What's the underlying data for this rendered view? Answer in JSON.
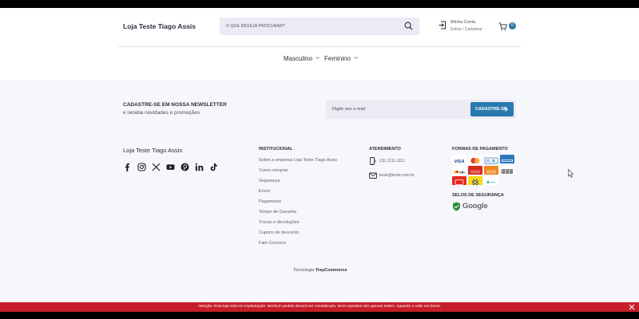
{
  "header": {
    "store_name": "Loja Teste Tiago Assis",
    "search_placeholder": "O QUE DESEJA PROCURAR?",
    "account_title": "Minha Conta",
    "account_sub": "Entrar / Cadastrar",
    "cart_count": "0"
  },
  "nav": {
    "items": [
      {
        "label": "Masculino"
      },
      {
        "label": "Feminino"
      }
    ]
  },
  "newsletter": {
    "title": "CADASTRE-SE EM NOSSA NEWSLETTER",
    "subtitle": "e receba novidades e promoções",
    "email_placeholder": "Digite seu e-mail",
    "button_label": "CADASTRE-SE"
  },
  "footer": {
    "store_name": "Loja Teste Tiago Assis",
    "social_icons": [
      "facebook-icon",
      "instagram-icon",
      "x-icon",
      "youtube-icon",
      "pinterest-icon",
      "linkedin-icon",
      "tiktok-icon"
    ],
    "institucional": {
      "title": "INSTITUCIONAL",
      "links": [
        "Sobre a empresa Loja Teste Tiago Assis",
        "Como comprar",
        "Segurança",
        "Envio",
        "Pagamento",
        "Tempo de Garantia",
        "Trocas e devoluções",
        "Cupons de desconto",
        "Fale Conosco"
      ]
    },
    "atendimento": {
      "title": "ATENDIMENTO",
      "phone": "(11) 1111-1111",
      "email": "teste@teste.com.br"
    },
    "pagamento": {
      "title": "FORMAS DE PAGAMENTO",
      "methods": [
        "visa",
        "mastercard",
        "amex-1",
        "amex-2",
        "elo",
        "hipercard",
        "diners",
        "boleto",
        "hiper",
        "banco-do-brasil",
        "pix"
      ]
    },
    "seguranca": {
      "title": "SELOS DE SEGURANÇA",
      "seal": "Google"
    },
    "tech_prefix": "Tecnologia",
    "tech_brand": "TrayCommerce"
  },
  "warning": {
    "text": "Atenção: Esta loja está em implantação. Nenhum pedido deverá ser considerado, itens expostos são apenas testes. Aguarde e volte em breve."
  },
  "colors": {
    "accent": "#2a7ab0",
    "warning_bg": "#c41f2a",
    "page_bg": "#f6f7fa"
  }
}
